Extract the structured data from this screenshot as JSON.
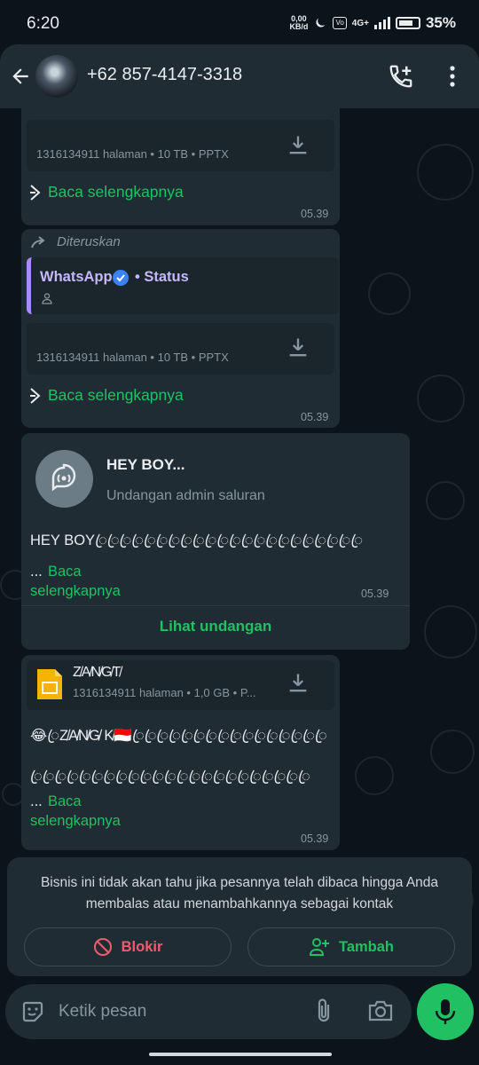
{
  "status_bar": {
    "time": "6:20",
    "net_speed_top": "0,00",
    "net_speed_bottom": "KB/d",
    "network": "4G+",
    "battery_percent": "35%"
  },
  "header": {
    "contact": "+62 857-4147-3318"
  },
  "messages": [
    {
      "file_meta": "1316134911 halaman • 10 TB • PPTX",
      "read_more": "Baca selengkapnya",
      "time": "05.39"
    },
    {
      "forwarded_label": "Diteruskan",
      "quote_sender": "WhatsApp",
      "quote_suffix": "• Status",
      "file_meta": "1316134911 halaman • 10 TB • PPTX",
      "read_more": "Baca selengkapnya",
      "time": "05.39"
    },
    {
      "invite_title": "HEY BOY...",
      "invite_subtitle": "Undangan admin saluran",
      "text": "HEY BOY",
      "text_filler": "ꦿꦿꦿꦿꦿꦿꦿꦿꦿꦿꦿꦿꦿꦿꦿꦿꦿꦿꦿꦿꦿꦿ",
      "ellipsis": "...",
      "read_more_1": "Baca",
      "read_more_2": "selengkapnya",
      "time": "05.39",
      "action": "Lihat undangan"
    },
    {
      "file_name": "Z̸A̸N̸G̸T̸",
      "file_meta": "1316134911 halaman • 1,0 GB • P...",
      "text_line1": "😂ꦿZ̸A̸N̸G̸ K̸🇮🇩ꦿꦿꦿꦿꦿꦿꦿꦿꦿꦿꦿꦿꦿꦿꦿꦿ",
      "text_line2": "ꦿꦿꦿꦿꦿꦿꦿꦿꦿꦿꦿꦿꦿꦿꦿꦿꦿꦿꦿꦿꦿꦿꦿ",
      "ellipsis": "...",
      "read_more_1": "Baca",
      "read_more_2": "selengkapnya",
      "time": "05.39"
    }
  ],
  "business_notice": {
    "text": "Bisnis ini tidak akan tahu jika pesannya telah dibaca hingga Anda membalas atau menambahkannya sebagai kontak",
    "block_label": "Blokir",
    "add_label": "Tambah"
  },
  "composer": {
    "placeholder": "Ketik pesan"
  },
  "colors": {
    "accent_green": "#21c063",
    "block_red": "#f15c6d",
    "bubble_bg": "#202c33",
    "header_bg": "#1f2c34"
  }
}
